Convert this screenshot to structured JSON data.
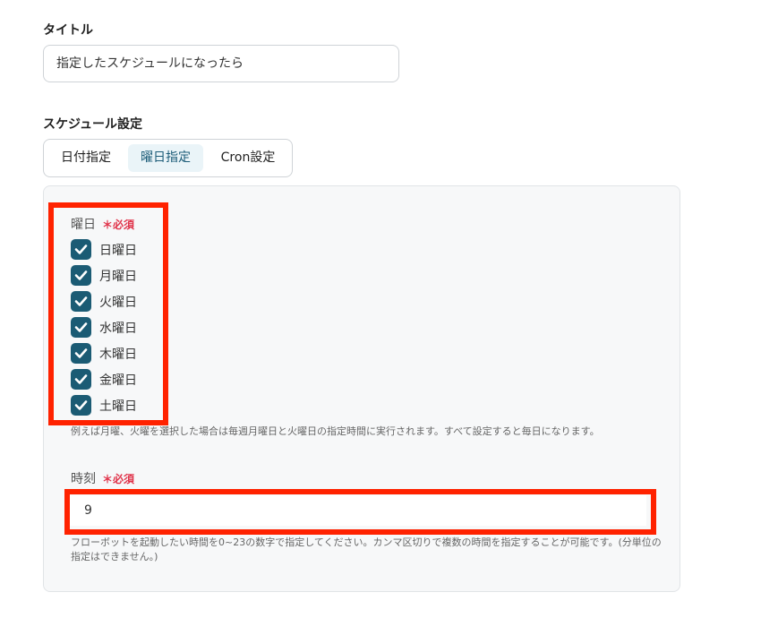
{
  "title_field": {
    "label": "タイトル",
    "value": "指定したスケジュールになったら"
  },
  "schedule": {
    "label": "スケジュール設定",
    "tabs": [
      {
        "label": "日付指定",
        "active": false
      },
      {
        "label": "曜日指定",
        "active": true
      },
      {
        "label": "Cron設定",
        "active": false
      }
    ]
  },
  "weekday": {
    "label": "曜日",
    "required": "＊必須",
    "days": [
      {
        "label": "日曜日",
        "checked": true
      },
      {
        "label": "月曜日",
        "checked": true
      },
      {
        "label": "火曜日",
        "checked": true
      },
      {
        "label": "水曜日",
        "checked": true
      },
      {
        "label": "木曜日",
        "checked": true
      },
      {
        "label": "金曜日",
        "checked": true
      },
      {
        "label": "土曜日",
        "checked": true
      }
    ],
    "help": "例えば月曜、火曜を選択した場合は毎週月曜日と火曜日の指定時間に実行されます。すべて設定すると毎日になります。"
  },
  "time": {
    "label": "時刻",
    "required": "＊必須",
    "value": "9",
    "help_line1": "フローボットを起動したい時間を0~23の数字で指定してください。カンマ区切りで複数の時間を指定することが可能です。(分単位の",
    "help_line2": "指定はできません。)"
  },
  "colors": {
    "accent": "#1b5b74",
    "required": "#e0334a",
    "highlight": "#ff2200",
    "active_tab_bg": "#eaf4f8"
  }
}
